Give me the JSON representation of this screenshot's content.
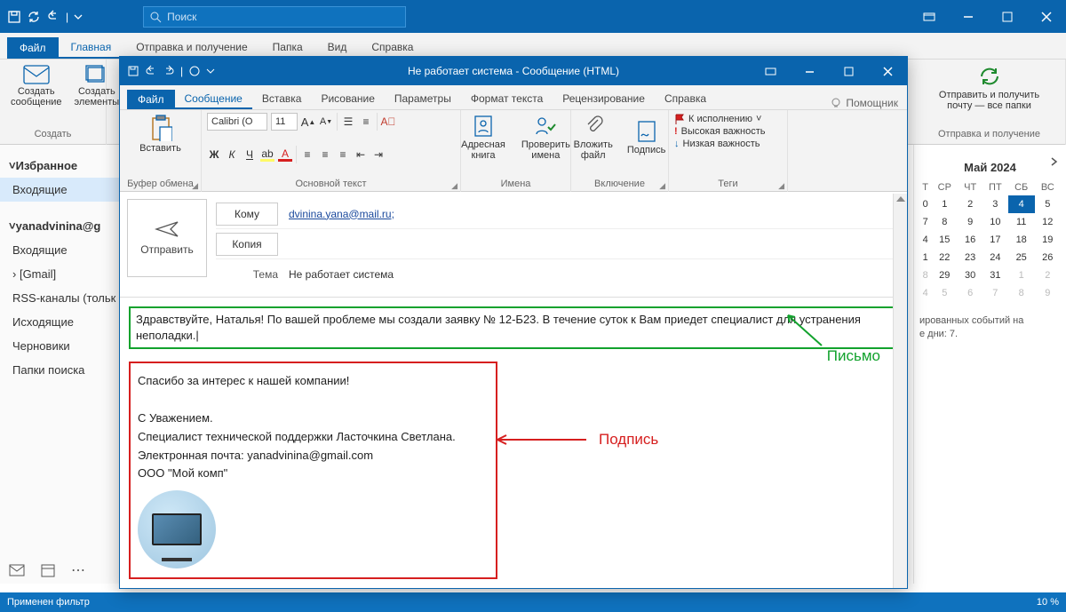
{
  "main": {
    "search_placeholder": "Поиск",
    "tabs": {
      "file": "Файл",
      "home": "Главная",
      "sendrecv": "Отправка и получение",
      "folder": "Папка",
      "view": "Вид",
      "help": "Справка"
    },
    "ribbon": {
      "new_mail": "Создать\nсообщение",
      "new_items": "Создать\nэлементы",
      "group_create": "Создать",
      "sendrecv_all": "Отправить и получить\nпочту — все папки",
      "group_sendrecv": "Отправка и получение"
    },
    "nav": {
      "fav_header": "Избранное",
      "inbox": "Входящие",
      "account": "yanadvinina@g",
      "items": [
        "Входящие",
        "[Gmail]",
        "RSS-каналы (тольк",
        "Исходящие",
        "Черновики",
        "Папки поиска"
      ]
    },
    "status": "Применен фильтр",
    "status_right": "10 %"
  },
  "calendar": {
    "title": "Май 2024",
    "dow": [
      "Т",
      "СР",
      "ЧТ",
      "ПТ",
      "СБ",
      "ВС"
    ],
    "rows": [
      [
        "0",
        "1",
        "2",
        "3",
        "4",
        "5"
      ],
      [
        "7",
        "8",
        "9",
        "10",
        "11",
        "12"
      ],
      [
        "4",
        "15",
        "16",
        "17",
        "18",
        "19"
      ],
      [
        "1",
        "22",
        "23",
        "24",
        "25",
        "26"
      ],
      [
        "8",
        "29",
        "30",
        "31",
        "1",
        "2"
      ],
      [
        "4",
        "5",
        "6",
        "7",
        "8",
        "9"
      ]
    ],
    "today": "4",
    "note": "ированных событий на\nе дни: 7."
  },
  "message": {
    "win_title": "Не работает система  -  Сообщение (HTML)",
    "tabs": {
      "file": "Файл",
      "message": "Сообщение",
      "insert": "Вставка",
      "draw": "Рисование",
      "options": "Параметры",
      "format": "Формат текста",
      "review": "Рецензирование",
      "help": "Справка",
      "helper": "Помощник"
    },
    "ribbon": {
      "paste": "Вставить",
      "clipboard": "Буфер обмена",
      "font_name": "Calibri (О",
      "font_size": "11",
      "basic_text": "Основной текст",
      "addr_book": "Адресная\nкнига",
      "check_names": "Проверить\nимена",
      "names": "Имена",
      "attach": "Вложить\nфайл",
      "signature": "Подпись",
      "include": "Включение",
      "followup": "К исполнению",
      "high": "Высокая важность",
      "low": "Низкая важность",
      "tags": "Теги"
    },
    "compose": {
      "send": "Отправить",
      "to_btn": "Кому",
      "cc_btn": "Копия",
      "subject_lbl": "Тема",
      "to_value": "dvinina.yana@mail.ru;",
      "subject_value": "Не работает система"
    },
    "body_greeting": "Здравствуйте, Наталья! По вашей проблеме мы создали заявку № 12-Б23. В течение суток к Вам приедет специалист для устранения неполадки.|",
    "sig_thanks": "Спасибо за интерес к нашей компании!",
    "sig_regards": "С Уважением.",
    "sig_role": "Специалист технической поддержки Ласточкина Светлана.",
    "sig_email": "Электронная почта: yanadvinina@gmail.com",
    "sig_company": "ООО \"Мой комп\"",
    "callout_letter": "Письмо",
    "callout_signature": "Подпись"
  }
}
